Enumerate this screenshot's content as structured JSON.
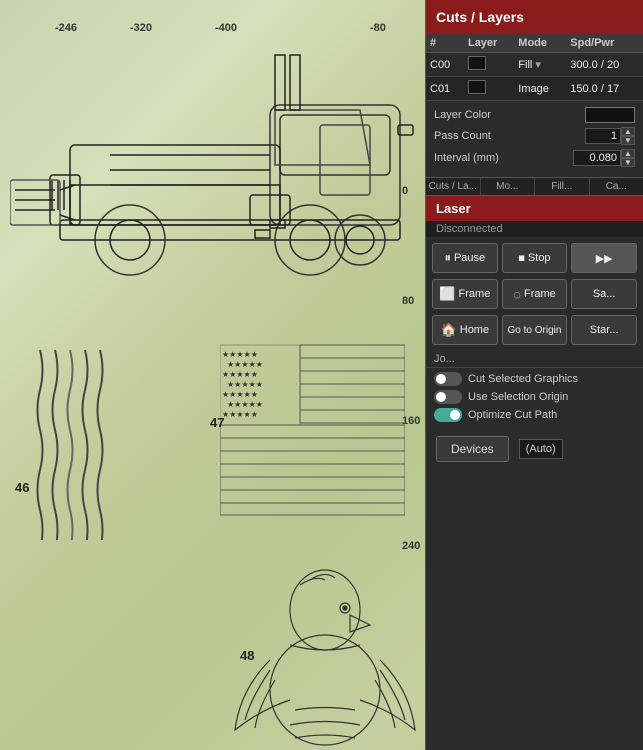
{
  "panel": {
    "cuts_layers_title": "Cuts / Layers",
    "laser_title": "Laser",
    "laser_status": "Disconnected"
  },
  "table": {
    "headers": [
      "#",
      "Layer",
      "Mode",
      "Spd/Pwr"
    ],
    "rows": [
      {
        "id": "C00",
        "color": "black",
        "mode": "Fill",
        "spd_pwr": "300.0 / 20"
      },
      {
        "id": "C01",
        "color": "black",
        "mode": "Image",
        "spd_pwr": "150.0 / 17"
      }
    ]
  },
  "properties": {
    "layer_color_label": "Layer Color",
    "pass_count_label": "Pass Count",
    "pass_count_value": "1",
    "interval_label": "Interval (mm)",
    "interval_value": "0.080"
  },
  "mini_tabs": [
    "Cuts / La...",
    "Mo...",
    "Fill...",
    "Ca..."
  ],
  "buttons": {
    "pause": "Pause",
    "stop": "Stop",
    "frame1": "Frame",
    "frame2": "Frame",
    "save": "Sa...",
    "home": "Home",
    "go_to_origin": "Go to Origin",
    "start": "Star..."
  },
  "join_label": "Jo...",
  "checkboxes": {
    "cut_selected": "Cut Selected Graphics",
    "use_selection": "Use Selection Origin",
    "optimize": "Optimize Cut Path"
  },
  "devices_btn": "Devices",
  "auto_val": "(Auto)",
  "canvas": {
    "rulers": [
      "-246",
      "-320",
      "-400",
      "-80",
      "0",
      "80",
      "160",
      "240"
    ],
    "labels": [
      "46",
      "47",
      "48"
    ]
  }
}
